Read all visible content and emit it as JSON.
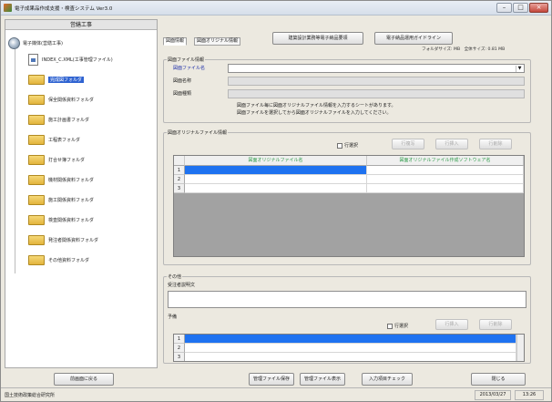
{
  "window": {
    "title": "電子成果品作成支援・検査システム Ver3.0",
    "controls": [
      "–",
      "□",
      "×"
    ]
  },
  "left_panel": {
    "heading": "営繕工事",
    "root": {
      "label": "電子媒体(営繕工事)",
      "icon": "cd-disc-icon"
    },
    "items": [
      {
        "label": "INDEX_C.XML(工事管理ファイル)",
        "icon": "xml-document-icon"
      },
      {
        "label": "完成図フォルダ",
        "icon": "folder-icon",
        "selected": true
      },
      {
        "label": "保全関係資料フォルダ",
        "icon": "folder-icon"
      },
      {
        "label": "施工計画書フォルダ",
        "icon": "folder-icon"
      },
      {
        "label": "工程表フォルダ",
        "icon": "folder-icon"
      },
      {
        "label": "打合せ簿フォルダ",
        "icon": "folder-icon"
      },
      {
        "label": "機材関係資料フォルダ",
        "icon": "folder-icon"
      },
      {
        "label": "施工関係資料フォルダ",
        "icon": "folder-icon"
      },
      {
        "label": "検査関係資料フォルダ",
        "icon": "folder-icon"
      },
      {
        "label": "発注者関係資料フォルダ",
        "icon": "folder-icon"
      },
      {
        "label": "その他資料フォルダ",
        "icon": "folder-icon"
      }
    ]
  },
  "tabs": [
    {
      "label": "図面情報",
      "active": true
    },
    {
      "label": "図面オリジナル情報",
      "active": false
    }
  ],
  "top_buttons": {
    "btn1": "建築設計業務等電子納品要領",
    "btn2": "電子納品運用ガイドライン"
  },
  "size_info": {
    "folder_label": "フォルダサイズ:",
    "folder_value": "MB",
    "total_label": "全体サイズ:",
    "total_value": "0.81 MB"
  },
  "drawing_info": {
    "group_title": "図面ファイル情報",
    "file_name_label": "図面ファイル名",
    "drawing_name_label": "図面名称",
    "drawing_type_label": "図面種類",
    "note1": "図面ファイル毎に図面オリジナルファイル情報を入力するシートがあります。",
    "note2": "図面ファイルを選択してから図面オリジナルファイルを入力してください。"
  },
  "original_info": {
    "group_title": "図面オリジナルファイル情報",
    "row_select": "行選択",
    "copy": "行複写",
    "insert": "行挿入",
    "delete": "行削除",
    "columns": [
      "図面オリジナルファイル名",
      "図面オリジナルファイル作成ソフトウェア名"
    ],
    "rows": [
      "1",
      "2",
      "3"
    ]
  },
  "other": {
    "group_title": "その他",
    "client_note_label": "受注者説明文",
    "reserve_label": "予備",
    "row_select": "行選択",
    "insert": "行挿入",
    "delete": "行削除",
    "rows": [
      "1",
      "2",
      "3"
    ]
  },
  "bottom_buttons": {
    "back": "前画面に戻る",
    "save": "管理ファイル保存",
    "show": "管理ファイル表示",
    "check": "入力項目チェック",
    "close": "閉じる"
  },
  "status_bar": {
    "ministry": "国土技術政策総合研究所",
    "date": "2013/03/27",
    "time": "13:26"
  },
  "colors": {
    "selection_blue": "#1e72f0",
    "header_green": "#2e9b4a",
    "label_blue": "#2233aa"
  }
}
